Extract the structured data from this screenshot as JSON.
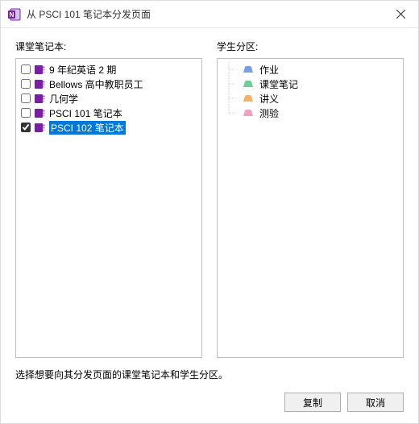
{
  "title": "从 PSCI 101 笔记本分发页面",
  "left": {
    "label": "课堂笔记本:",
    "items": [
      {
        "label": "9 年纪英语 2 期",
        "checked": false,
        "color": "#7a1fa2",
        "selected": false
      },
      {
        "label": "Bellows 高中教职员工",
        "checked": false,
        "color": "#7a1fa2",
        "selected": false
      },
      {
        "label": "几何学",
        "checked": false,
        "color": "#7a1fa2",
        "selected": false
      },
      {
        "label": "PSCI 101 笔记本",
        "checked": false,
        "color": "#7a1fa2",
        "selected": false
      },
      {
        "label": "PSCI 102 笔记本",
        "checked": true,
        "color": "#7a1fa2",
        "selected": true
      }
    ]
  },
  "right": {
    "label": "学生分区:",
    "items": [
      {
        "label": "作业",
        "color": "#7a9fe6"
      },
      {
        "label": "课堂笔记",
        "color": "#6fcf97"
      },
      {
        "label": "讲义",
        "color": "#f5b26b"
      },
      {
        "label": "测验",
        "color": "#f29fc5"
      }
    ]
  },
  "hint": "选择想要向其分发页面的课堂笔记本和学生分区。",
  "buttons": {
    "copy": "复制",
    "cancel": "取消"
  }
}
